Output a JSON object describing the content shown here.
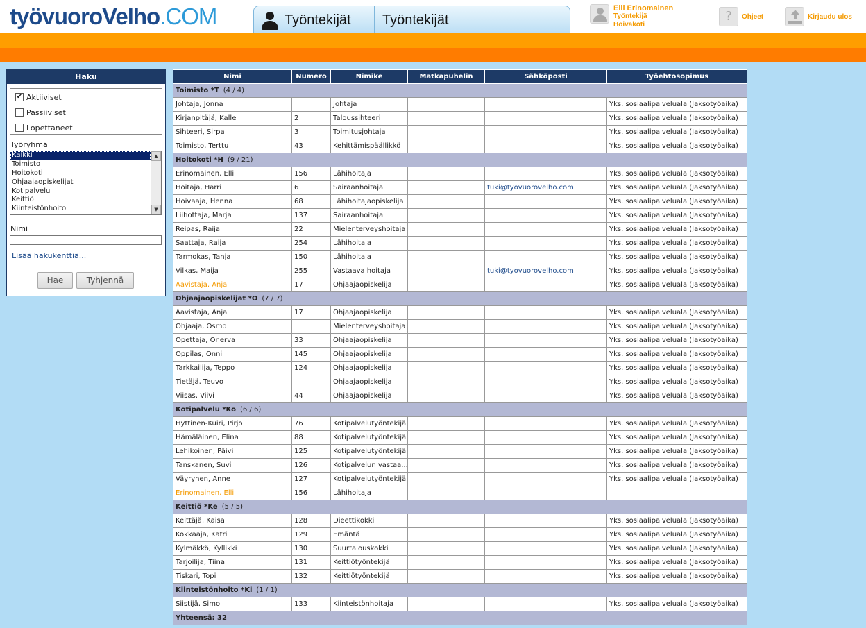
{
  "header": {
    "logo_part1": "työvuoro",
    "logo_part2": "Velho",
    "logo_part3": ".COM",
    "tab1_label": "Työntekijät",
    "tab2_label": "Työntekijät",
    "user_name": "Elli Erinomainen",
    "user_role": "Työntekijä",
    "user_unit": "Hoivakoti",
    "help_label": "Ohjeet",
    "logout_label": "Kirjaudu ulos"
  },
  "colors": {
    "brand_dark": "#1d3a66",
    "accent_orange": "#f49a00",
    "page_bg": "#b2dcf5"
  },
  "search": {
    "title": "Haku",
    "statuses": [
      {
        "label": "Aktiiviset",
        "checked": true
      },
      {
        "label": "Passiiviset",
        "checked": false
      },
      {
        "label": "Lopettaneet",
        "checked": false
      }
    ],
    "group_label": "Työryhmä",
    "groups": [
      "Kaikki",
      "Toimisto",
      "Hoitokoti",
      "Ohjaajaopiskelijat",
      "Kotipalvelu",
      "Keittiö",
      "Kiinteistönhoito"
    ],
    "selected_group": "Kaikki",
    "name_label": "Nimi",
    "name_value": "",
    "more_fields_link": "Lisää hakukenttiä...",
    "search_button": "Hae",
    "clear_button": "Tyhjennä"
  },
  "table": {
    "columns": [
      "Nimi",
      "Numero",
      "Nimike",
      "Matkapuhelin",
      "Sähköposti",
      "Työehtosopimus"
    ],
    "groups": [
      {
        "name": "Toimisto *T",
        "count": "(4 / 4)",
        "rows": [
          {
            "name": "Johtaja, Jonna",
            "number": "",
            "title": "Johtaja",
            "phone": "",
            "email": "",
            "contract": "Yks. sosiaalipalveluala (Jaksotyöaika)",
            "highlight": false
          },
          {
            "name": "Kirjanpitäjä, Kalle",
            "number": "2",
            "title": "Taloussihteeri",
            "phone": "",
            "email": "",
            "contract": "Yks. sosiaalipalveluala (Jaksotyöaika)",
            "highlight": false
          },
          {
            "name": "Sihteeri, Sirpa",
            "number": "3",
            "title": "Toimitusjohtaja",
            "phone": "",
            "email": "",
            "contract": "Yks. sosiaalipalveluala (Jaksotyöaika)",
            "highlight": false
          },
          {
            "name": "Toimisto, Terttu",
            "number": "43",
            "title": "Kehittämispäällikkö",
            "phone": "",
            "email": "",
            "contract": "Yks. sosiaalipalveluala (Jaksotyöaika)",
            "highlight": false
          }
        ]
      },
      {
        "name": "Hoitokoti *H",
        "count": "(9 / 21)",
        "rows": [
          {
            "name": "Erinomainen, Elli",
            "number": "156",
            "title": "Lähihoitaja",
            "phone": "",
            "email": "",
            "contract": "Yks. sosiaalipalveluala (Jaksotyöaika)",
            "highlight": false
          },
          {
            "name": "Hoitaja, Harri",
            "number": "6",
            "title": "Sairaanhoitaja",
            "phone": "",
            "email": "tuki@tyovuorovelho.com",
            "contract": "Yks. sosiaalipalveluala (Jaksotyöaika)",
            "highlight": false
          },
          {
            "name": "Hoivaaja, Henna",
            "number": "68",
            "title": "Lähihoitajaopiskelija",
            "phone": "",
            "email": "",
            "contract": "Yks. sosiaalipalveluala (Jaksotyöaika)",
            "highlight": false
          },
          {
            "name": "Liihottaja, Marja",
            "number": "137",
            "title": "Sairaanhoitaja",
            "phone": "",
            "email": "",
            "contract": "Yks. sosiaalipalveluala (Jaksotyöaika)",
            "highlight": false
          },
          {
            "name": "Reipas, Raija",
            "number": "22",
            "title": "Mielenterveyshoitaja",
            "phone": "",
            "email": "",
            "contract": "Yks. sosiaalipalveluala (Jaksotyöaika)",
            "highlight": false
          },
          {
            "name": "Saattaja, Raija",
            "number": "254",
            "title": "Lähihoitaja",
            "phone": "",
            "email": "",
            "contract": "Yks. sosiaalipalveluala (Jaksotyöaika)",
            "highlight": false
          },
          {
            "name": "Tarmokas, Tanja",
            "number": "150",
            "title": "Lähihoitaja",
            "phone": "",
            "email": "",
            "contract": "Yks. sosiaalipalveluala (Jaksotyöaika)",
            "highlight": false
          },
          {
            "name": "Vilkas, Maija",
            "number": "255",
            "title": "Vastaava hoitaja",
            "phone": "",
            "email": "tuki@tyovuorovelho.com",
            "contract": "Yks. sosiaalipalveluala (Jaksotyöaika)",
            "highlight": false
          },
          {
            "name": "Aavistaja, Anja",
            "number": "17",
            "title": "Ohjaajaopiskelija",
            "phone": "",
            "email": "",
            "contract": "Yks. sosiaalipalveluala (Jaksotyöaika)",
            "highlight": true
          }
        ]
      },
      {
        "name": "Ohjaajaopiskelijat *O",
        "count": "(7 / 7)",
        "rows": [
          {
            "name": "Aavistaja, Anja",
            "number": "17",
            "title": "Ohjaajaopiskelija",
            "phone": "",
            "email": "",
            "contract": "Yks. sosiaalipalveluala (Jaksotyöaika)",
            "highlight": false
          },
          {
            "name": "Ohjaaja, Osmo",
            "number": "",
            "title": "Mielenterveyshoitaja",
            "phone": "",
            "email": "",
            "contract": "Yks. sosiaalipalveluala (Jaksotyöaika)",
            "highlight": false
          },
          {
            "name": "Opettaja, Onerva",
            "number": "33",
            "title": "Ohjaajaopiskelija",
            "phone": "",
            "email": "",
            "contract": "Yks. sosiaalipalveluala (Jaksotyöaika)",
            "highlight": false
          },
          {
            "name": "Oppilas, Onni",
            "number": "145",
            "title": "Ohjaajaopiskelija",
            "phone": "",
            "email": "",
            "contract": "Yks. sosiaalipalveluala (Jaksotyöaika)",
            "highlight": false
          },
          {
            "name": "Tarkkailija, Teppo",
            "number": "124",
            "title": "Ohjaajaopiskelija",
            "phone": "",
            "email": "",
            "contract": "Yks. sosiaalipalveluala (Jaksotyöaika)",
            "highlight": false
          },
          {
            "name": "Tietäjä, Teuvo",
            "number": "",
            "title": "Ohjaajaopiskelija",
            "phone": "",
            "email": "",
            "contract": "Yks. sosiaalipalveluala (Jaksotyöaika)",
            "highlight": false
          },
          {
            "name": "Viisas, Viivi",
            "number": "44",
            "title": "Ohjaajaopiskelija",
            "phone": "",
            "email": "",
            "contract": "Yks. sosiaalipalveluala (Jaksotyöaika)",
            "highlight": false
          }
        ]
      },
      {
        "name": "Kotipalvelu *Ko",
        "count": "(6 / 6)",
        "rows": [
          {
            "name": "Hyttinen-Kuiri, Pirjo",
            "number": "76",
            "title": "Kotipalvelutyöntekijä",
            "phone": "",
            "email": "",
            "contract": "Yks. sosiaalipalveluala (Jaksotyöaika)",
            "highlight": false
          },
          {
            "name": "Hämäläinen, Elina",
            "number": "88",
            "title": "Kotipalvelutyöntekijä",
            "phone": "",
            "email": "",
            "contract": "Yks. sosiaalipalveluala (Jaksotyöaika)",
            "highlight": false
          },
          {
            "name": "Lehikoinen, Päivi",
            "number": "125",
            "title": "Kotipalvelutyöntekijä",
            "phone": "",
            "email": "",
            "contract": "Yks. sosiaalipalveluala (Jaksotyöaika)",
            "highlight": false
          },
          {
            "name": "Tanskanen, Suvi",
            "number": "126",
            "title": "Kotipalvelun vastaa...",
            "phone": "",
            "email": "",
            "contract": "Yks. sosiaalipalveluala (Jaksotyöaika)",
            "highlight": false
          },
          {
            "name": "Väyrynen, Anne",
            "number": "127",
            "title": "Kotipalvelutyöntekijä",
            "phone": "",
            "email": "",
            "contract": "Yks. sosiaalipalveluala (Jaksotyöaika)",
            "highlight": false
          },
          {
            "name": "Erinomainen, Elli",
            "number": "156",
            "title": "Lähihoitaja",
            "phone": "",
            "email": "",
            "contract": "",
            "highlight": true
          }
        ]
      },
      {
        "name": "Keittiö *Ke",
        "count": "(5 / 5)",
        "rows": [
          {
            "name": "Keittäjä, Kaisa",
            "number": "128",
            "title": "Dieettikokki",
            "phone": "",
            "email": "",
            "contract": "Yks. sosiaalipalveluala (Jaksotyöaika)",
            "highlight": false
          },
          {
            "name": "Kokkaaja, Katri",
            "number": "129",
            "title": "Emäntä",
            "phone": "",
            "email": "",
            "contract": "Yks. sosiaalipalveluala (Jaksotyöaika)",
            "highlight": false
          },
          {
            "name": "Kylmäkkö, Kyllikki",
            "number": "130",
            "title": "Suurtalouskokki",
            "phone": "",
            "email": "",
            "contract": "Yks. sosiaalipalveluala (Jaksotyöaika)",
            "highlight": false
          },
          {
            "name": "Tarjoilija, Tiina",
            "number": "131",
            "title": "Keittiötyöntekijä",
            "phone": "",
            "email": "",
            "contract": "Yks. sosiaalipalveluala (Jaksotyöaika)",
            "highlight": false
          },
          {
            "name": "Tiskari, Topi",
            "number": "132",
            "title": "Keittiötyöntekijä",
            "phone": "",
            "email": "",
            "contract": "Yks. sosiaalipalveluala (Jaksotyöaika)",
            "highlight": false
          }
        ]
      },
      {
        "name": "Kiinteistönhoito *Ki",
        "count": "(1 / 1)",
        "rows": [
          {
            "name": "Siistijä, Simo",
            "number": "133",
            "title": "Kiinteistönhoitaja",
            "phone": "",
            "email": "",
            "contract": "Yks. sosiaalipalveluala (Jaksotyöaika)",
            "highlight": false
          }
        ]
      }
    ],
    "total_label": "Yhteensä: 32"
  }
}
